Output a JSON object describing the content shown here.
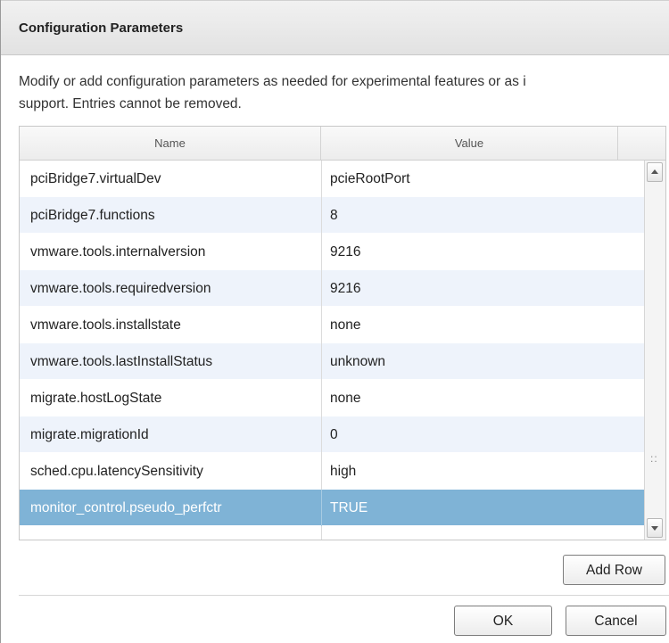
{
  "dialog": {
    "title": "Configuration Parameters",
    "description_line1": "Modify or add configuration parameters as needed for experimental features or as i",
    "description_line2": "support. Entries cannot be removed."
  },
  "grid": {
    "columns": {
      "name": "Name",
      "value": "Value"
    },
    "rows": [
      {
        "name": "pciBridge7.virtualDev",
        "value": "pcieRootPort"
      },
      {
        "name": "pciBridge7.functions",
        "value": "8"
      },
      {
        "name": "vmware.tools.internalversion",
        "value": "9216"
      },
      {
        "name": "vmware.tools.requiredversion",
        "value": "9216"
      },
      {
        "name": "vmware.tools.installstate",
        "value": "none"
      },
      {
        "name": "vmware.tools.lastInstallStatus",
        "value": "unknown"
      },
      {
        "name": "migrate.hostLogState",
        "value": "none"
      },
      {
        "name": "migrate.migrationId",
        "value": "0"
      },
      {
        "name": "sched.cpu.latencySensitivity",
        "value": "high"
      },
      {
        "name": "monitor_control.pseudo_perfctr",
        "value": "TRUE"
      },
      {
        "name": "",
        "value": ""
      }
    ],
    "selected_row_index": 9,
    "selection_color": "#7fb3d6",
    "alt_row_color": "#eef3fb"
  },
  "buttons": {
    "add_row": "Add Row",
    "ok": "OK",
    "cancel": "Cancel"
  }
}
